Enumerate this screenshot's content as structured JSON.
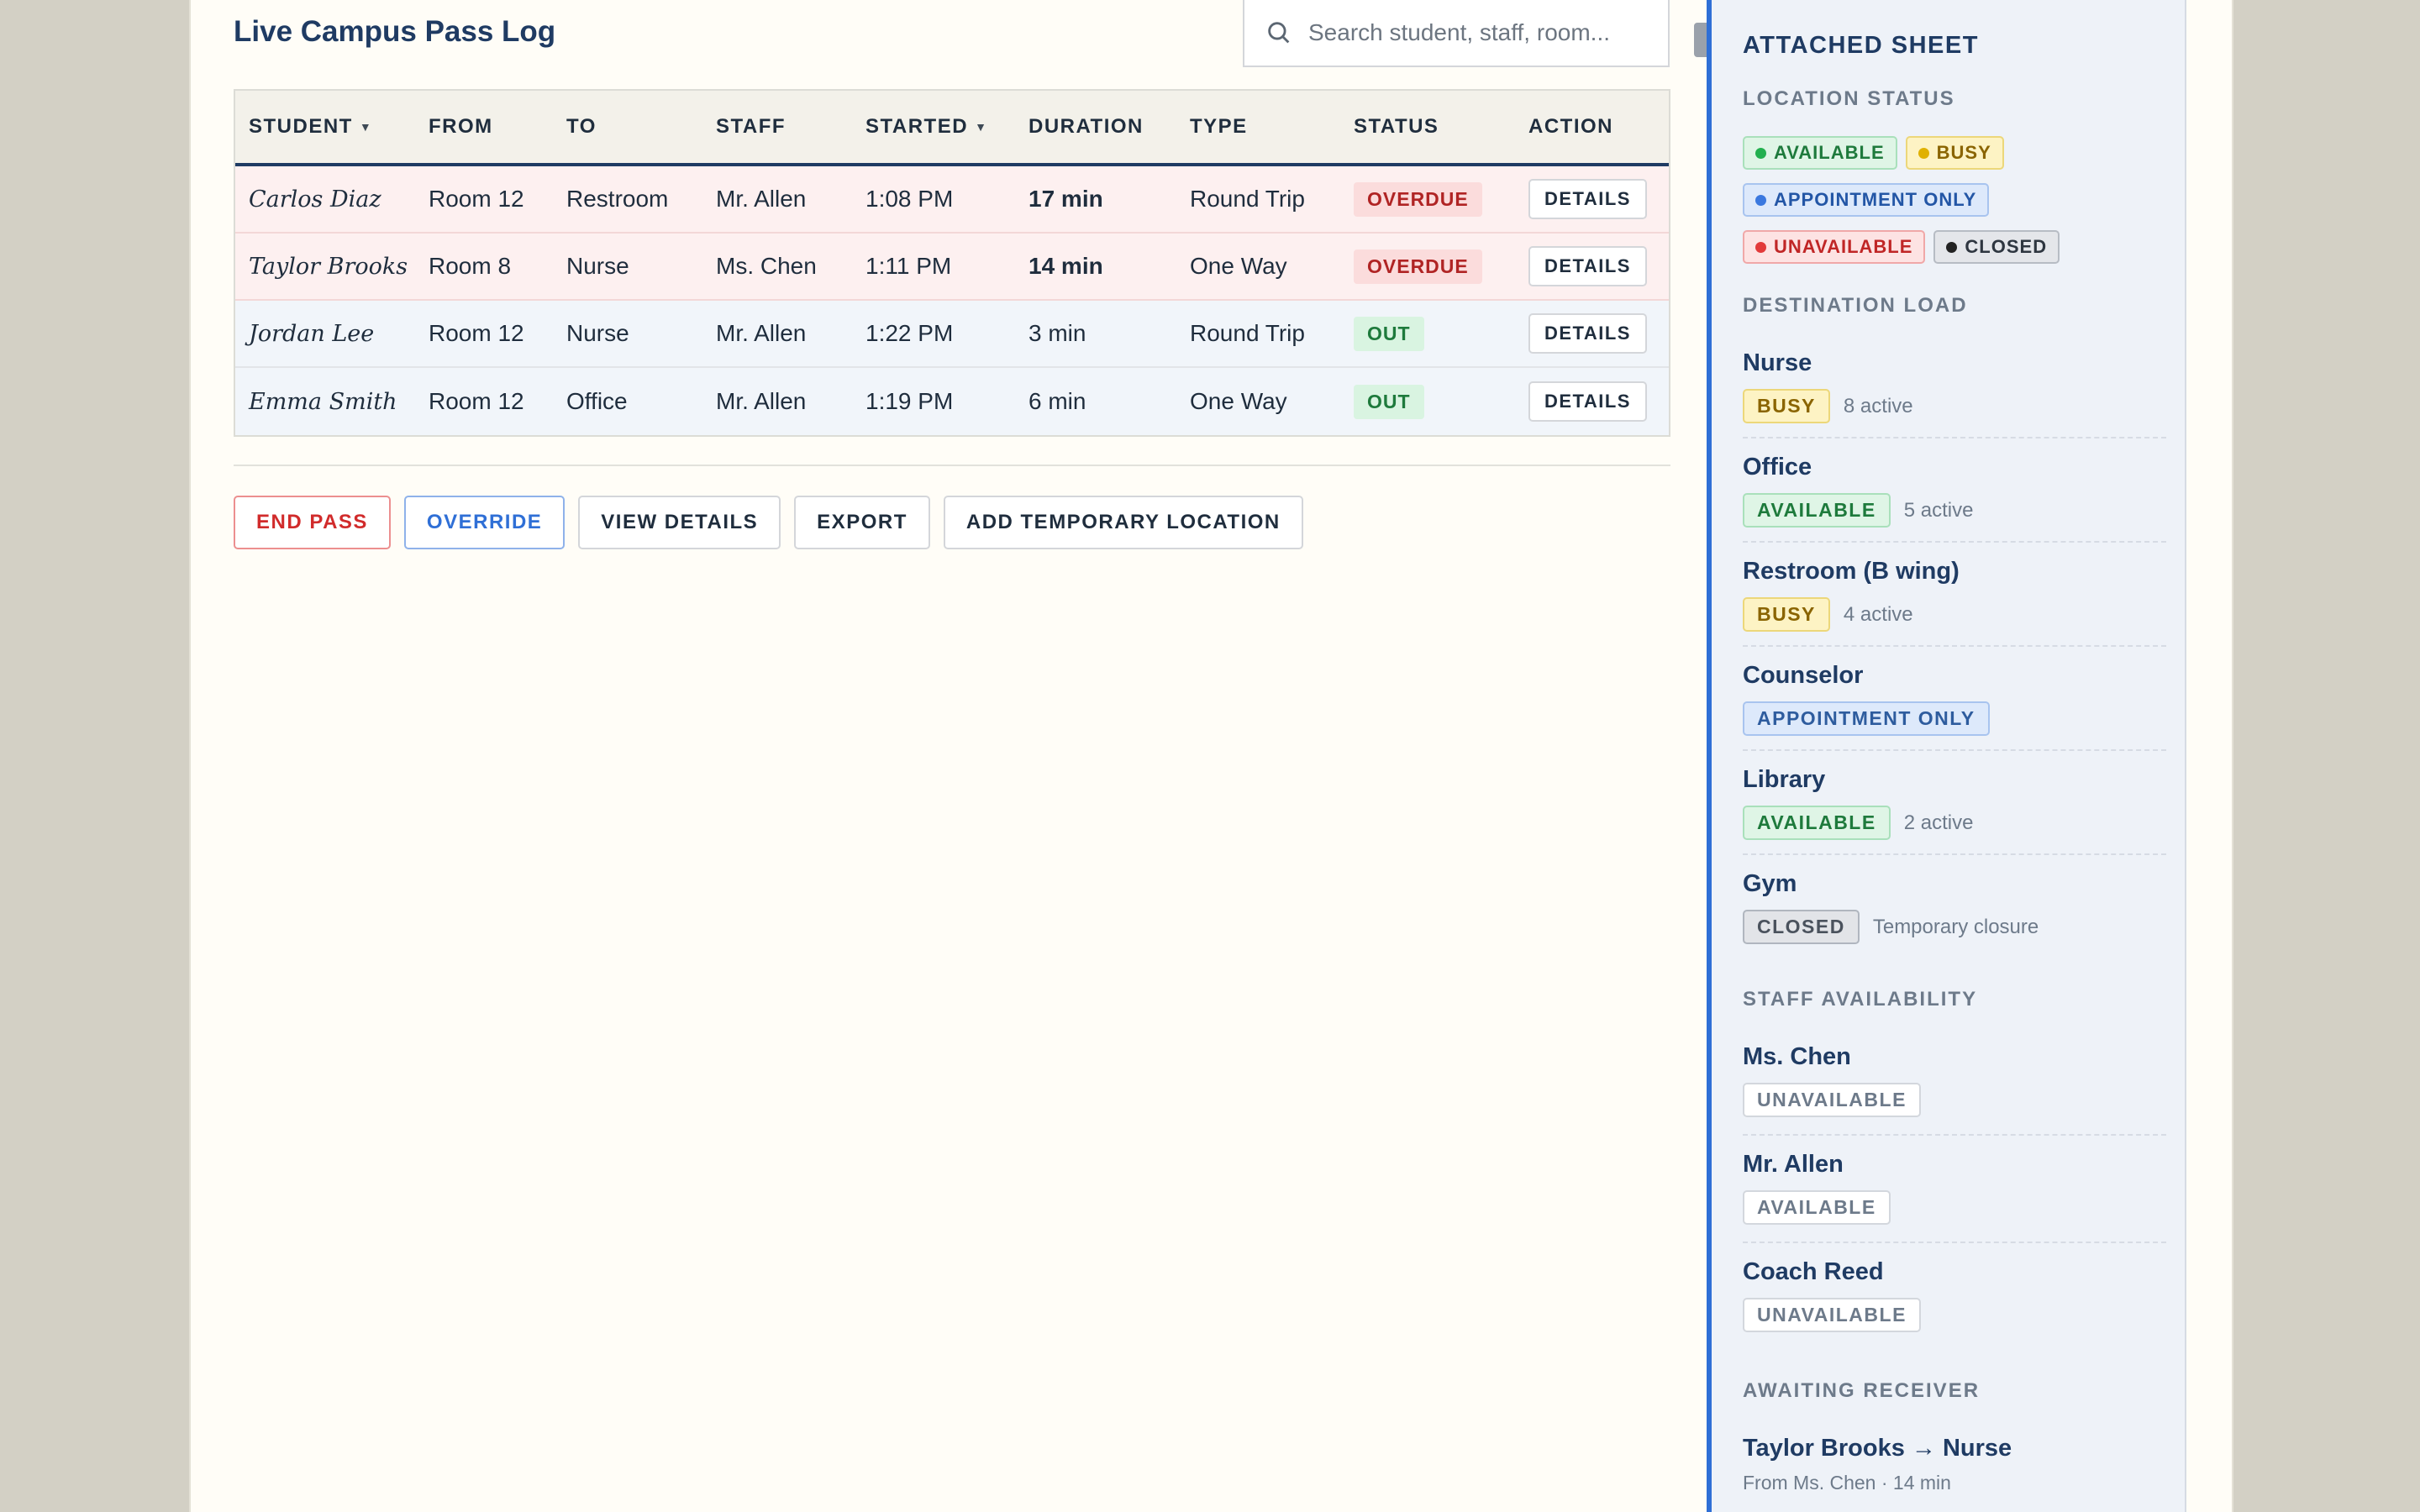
{
  "header": {
    "title": "Live Campus Pass Log",
    "search_placeholder": "Search student, staff, room..."
  },
  "table": {
    "columns": [
      "STUDENT",
      "FROM",
      "TO",
      "STAFF",
      "STARTED",
      "DURATION",
      "TYPE",
      "STATUS",
      "ACTION"
    ],
    "rows": [
      {
        "student": "Carlos Diaz",
        "from": "Room 12",
        "to": "Restroom",
        "staff": "Mr. Allen",
        "started": "1:08 PM",
        "duration": "17 min",
        "type": "Round Trip",
        "status": "OVERDUE",
        "action": "DETAILS"
      },
      {
        "student": "Taylor Brooks",
        "from": "Room 8",
        "to": "Nurse",
        "staff": "Ms. Chen",
        "started": "1:11 PM",
        "duration": "14 min",
        "type": "One Way",
        "status": "OVERDUE",
        "action": "DETAILS"
      },
      {
        "student": "Jordan Lee",
        "from": "Room 12",
        "to": "Nurse",
        "staff": "Mr. Allen",
        "started": "1:22 PM",
        "duration": "3 min",
        "type": "Round Trip",
        "status": "OUT",
        "action": "DETAILS"
      },
      {
        "student": "Emma Smith",
        "from": "Room 12",
        "to": "Office",
        "staff": "Mr. Allen",
        "started": "1:19 PM",
        "duration": "6 min",
        "type": "One Way",
        "status": "OUT",
        "action": "DETAILS"
      }
    ]
  },
  "actions": {
    "end_pass": "END PASS",
    "override": "OVERRIDE",
    "view_details": "VIEW DETAILS",
    "export": "EXPORT",
    "add_location": "ADD TEMPORARY LOCATION"
  },
  "panel": {
    "title": "ATTACHED SHEET",
    "location_status_heading": "LOCATION STATUS",
    "legend": {
      "available": "AVAILABLE",
      "busy": "BUSY",
      "appointment_only": "APPOINTMENT ONLY",
      "unavailable": "UNAVAILABLE",
      "closed": "CLOSED"
    },
    "destination_load_heading": "DESTINATION LOAD",
    "destinations": [
      {
        "name": "Nurse",
        "status": "BUSY",
        "note": "8 active"
      },
      {
        "name": "Office",
        "status": "AVAILABLE",
        "note": "5 active"
      },
      {
        "name": "Restroom (B wing)",
        "status": "BUSY",
        "note": "4 active"
      },
      {
        "name": "Counselor",
        "status": "APPOINTMENT ONLY",
        "note": ""
      },
      {
        "name": "Library",
        "status": "AVAILABLE",
        "note": "2 active"
      },
      {
        "name": "Gym",
        "status": "CLOSED",
        "note": "Temporary closure"
      }
    ],
    "staff_heading": "STAFF AVAILABILITY",
    "staff": [
      {
        "name": "Ms. Chen",
        "status": "UNAVAILABLE"
      },
      {
        "name": "Mr. Allen",
        "status": "AVAILABLE"
      },
      {
        "name": "Coach Reed",
        "status": "UNAVAILABLE"
      }
    ],
    "awaiting_heading": "AWAITING RECEIVER",
    "awaiting": {
      "title": "Taylor Brooks → Nurse",
      "detail": "From Ms. Chen · 14 min"
    }
  },
  "colors": {
    "accent": "#2f6fd6",
    "heading": "#1f3b63",
    "overdue": "#b02424",
    "out": "#1e7a3c"
  }
}
